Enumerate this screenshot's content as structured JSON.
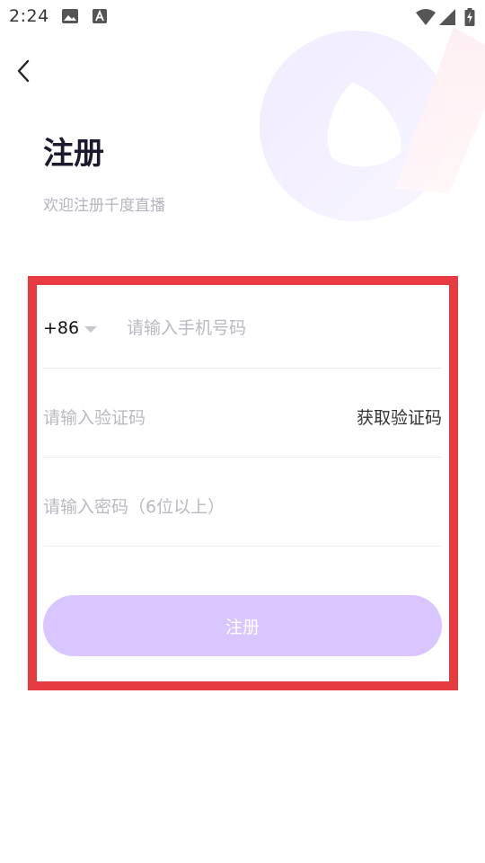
{
  "status_bar": {
    "time": "2:24",
    "icons": [
      "image-icon",
      "text-a-icon",
      "wifi-icon",
      "signal-icon",
      "battery-charging-icon"
    ]
  },
  "header": {
    "back_icon": "chevron-left-icon",
    "title": "注册",
    "subtitle": "欢迎注册千度直播"
  },
  "form": {
    "country_code": "+86",
    "phone_placeholder": "请输入手机号码",
    "code_placeholder": "请输入验证码",
    "get_code_label": "获取验证码",
    "password_placeholder": "请输入密码（6位以上）",
    "submit_label": "注册"
  },
  "colors": {
    "highlight_border": "#e63b41",
    "submit_background": "#d9c6fe",
    "placeholder": "#b9b9c1"
  }
}
